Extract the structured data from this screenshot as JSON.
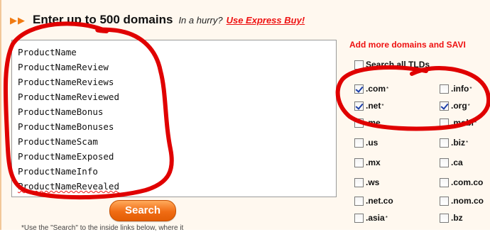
{
  "header": {
    "title": "Enter up to 500 domains",
    "hurry_text": "In a hurry?",
    "express_link": "Use Express Buy!"
  },
  "domain_input": {
    "lines": [
      "ProductName",
      "ProductNameReview",
      "ProductNameReviews",
      "ProductNameReviewed",
      "ProductNameBonus",
      "ProductNameBonuses",
      "ProductNameScam",
      "ProductNameExposed",
      "ProductNameInfo",
      "ProductNameRevealed"
    ]
  },
  "search_button": {
    "label": "Search"
  },
  "footnote": "*Use the \"Search\" to the inside links below, where it",
  "sidebar": {
    "add_more": "Add more domains and SAVI",
    "search_all_label": "Search all TLDs",
    "tlds": [
      {
        "label": ".com",
        "star": "*",
        "checked": true
      },
      {
        "label": ".info",
        "star": "*",
        "checked": false
      },
      {
        "label": ".net",
        "star": "*",
        "checked": true
      },
      {
        "label": ".org",
        "star": "*",
        "checked": true
      },
      {
        "label": ".me",
        "star": "",
        "checked": false
      },
      {
        "label": ".mobi",
        "star": "*",
        "checked": false
      },
      {
        "label": ".us",
        "star": "",
        "checked": false
      },
      {
        "label": ".biz",
        "star": "*",
        "checked": false
      },
      {
        "label": ".mx",
        "star": "",
        "checked": false
      },
      {
        "label": ".ca",
        "star": "",
        "checked": false
      },
      {
        "label": ".ws",
        "star": "",
        "checked": false
      },
      {
        "label": ".com.co",
        "star": "",
        "checked": false
      },
      {
        "label": ".net.co",
        "star": "",
        "checked": false
      },
      {
        "label": ".nom.co",
        "star": "",
        "checked": false
      },
      {
        "label": ".asia",
        "star": "*",
        "checked": false
      },
      {
        "label": ".bz",
        "star": "",
        "checked": false
      }
    ]
  },
  "colors": {
    "accent_orange": "#f07a12",
    "link_red": "#e11111",
    "marker_red": "#e00000",
    "panel_bg": "#fff8ef"
  },
  "icons": {
    "header_arrows": "double-arrow-right-icon",
    "checkbox": "checkbox-icon"
  }
}
